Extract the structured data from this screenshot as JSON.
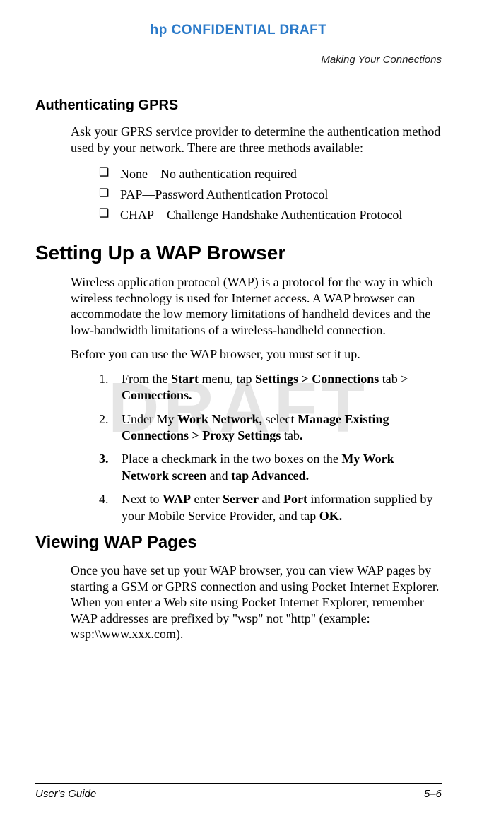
{
  "header": {
    "confidential": "hp CONFIDENTIAL DRAFT",
    "chapter": "Making Your Connections"
  },
  "watermark": "DRAFT",
  "section_auth": {
    "title": "Authenticating GPRS",
    "intro": "Ask your GPRS service provider to determine the authentication method used by your network. There are three methods available:",
    "bullets": [
      "None—No authentication required",
      "PAP—Password Authentication Protocol",
      "CHAP—Challenge Handshake Authentication Protocol"
    ]
  },
  "section_wap": {
    "title": "Setting Up a WAP Browser",
    "p1": "Wireless application protocol (WAP) is a protocol for the way in which wireless technology is used for Internet access. A WAP browser can accommodate the low memory limitations of handheld devices and the low-bandwidth limitations of a wireless-handheld connection.",
    "p2": "Before you can use the WAP browser, you must set it up.",
    "steps": {
      "s1": {
        "num": "1.",
        "a": "From the ",
        "b": "Start",
        "c": " menu, tap ",
        "d": "Settings > Connections",
        "e": " tab > ",
        "f": "Connections."
      },
      "s2": {
        "num": "2.",
        "a": "Under My ",
        "b": "Work Network,",
        "c": " select ",
        "d": "Manage Existing Connections > Proxy Settings",
        "e": " tab",
        "f": "."
      },
      "s3": {
        "num": "3.",
        "a": "Place a checkmark in the two boxes on the ",
        "b": "My Work Network screen",
        "c": " and ",
        "d": "tap Advanced."
      },
      "s4": {
        "num": "4.",
        "a": "Next to ",
        "b": "WAP",
        "c": " enter ",
        "d": "Server",
        "e": " and ",
        "f": "Port",
        "g": " information supplied by your Mobile Service Provider, and tap ",
        "h": "OK."
      }
    }
  },
  "section_view": {
    "title": "Viewing WAP Pages",
    "p1": "Once you have set up your WAP browser, you can view WAP pages by starting a GSM or GPRS connection and using Pocket Internet Explorer. When you enter a Web site using Pocket Internet Explorer, remember WAP addresses are prefixed by \"wsp\" not \"http\" (example: wsp:\\\\www.xxx.com)."
  },
  "footer": {
    "left": "User's Guide",
    "right": "5–6"
  }
}
